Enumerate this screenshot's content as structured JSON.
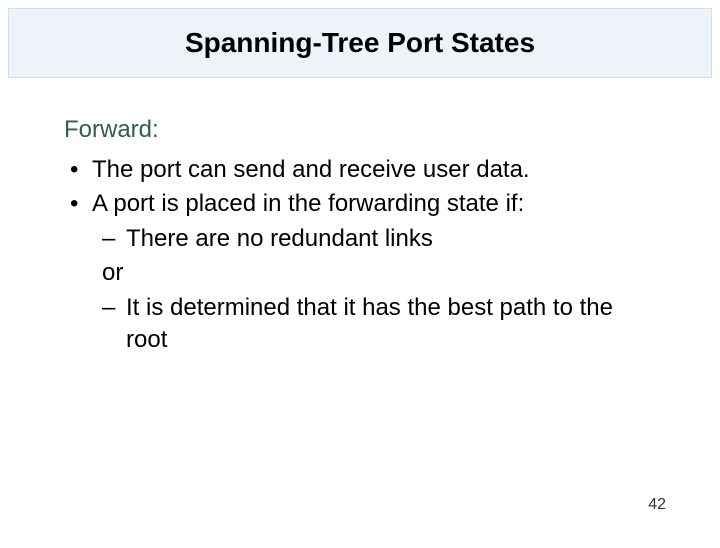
{
  "slide": {
    "title": "Spanning-Tree Port States",
    "subtitle": "Forward:",
    "bullets": [
      "The port can send and receive user data.",
      "A port is placed in the forwarding state if:"
    ],
    "sub": {
      "dash1": "There are no redundant links",
      "or": "or",
      "dash2": "It is determined that it has the best path to the root"
    },
    "page_number": "42"
  }
}
